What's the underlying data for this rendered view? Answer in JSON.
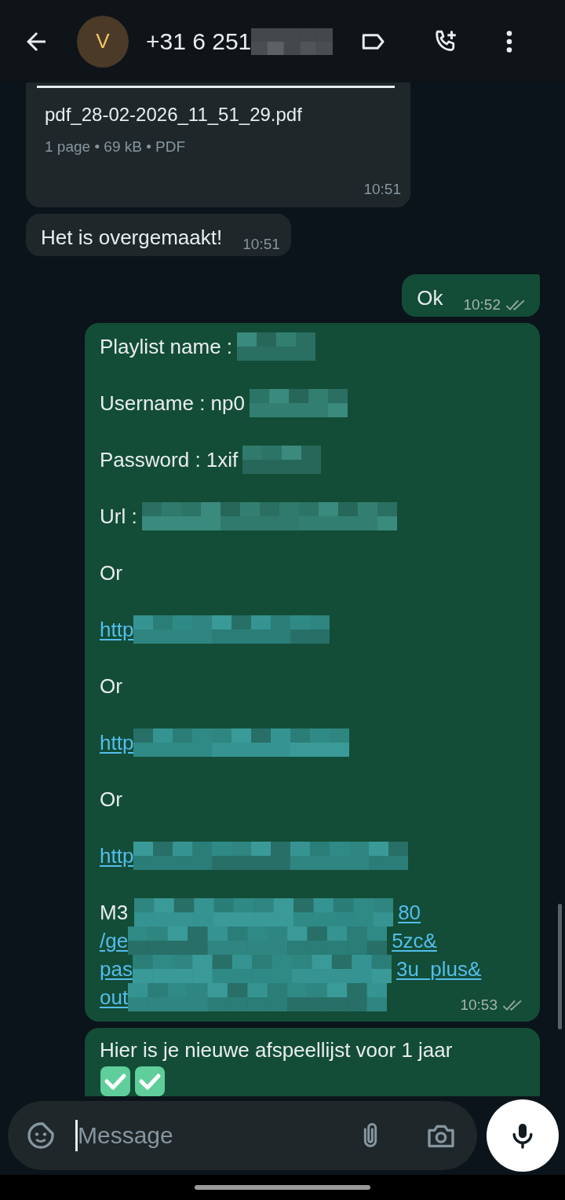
{
  "header": {
    "avatar_initial": "V",
    "title": "+31 6 251",
    "title_redacted": true
  },
  "messages": [
    {
      "kind": "document",
      "outgoing": false,
      "file_name": "pdf_28-02-2026_11_51_29.pdf",
      "meta": "1 page • 69 kB • PDF",
      "time": "10:51"
    },
    {
      "kind": "text",
      "outgoing": false,
      "text": "Het is overgemaakt!",
      "time": "10:51"
    },
    {
      "kind": "text",
      "outgoing": true,
      "text": "Ok",
      "time": "10:52",
      "read": false
    },
    {
      "kind": "rich",
      "outgoing": true,
      "time": "10:53",
      "read": false,
      "paragraphs": [
        {
          "lines": [
            [
              {
                "kind": "text",
                "text": "Playlist name :"
              },
              {
                "kind": "redacted"
              }
            ]
          ]
        },
        {
          "lines": [
            [
              {
                "kind": "text",
                "text": "Username : np0"
              },
              {
                "kind": "redacted"
              }
            ]
          ]
        },
        {
          "lines": [
            [
              {
                "kind": "text",
                "text": "Password : 1xif"
              },
              {
                "kind": "redacted"
              }
            ]
          ]
        },
        {
          "lines": [
            [
              {
                "kind": "text",
                "text": "Url :"
              },
              {
                "kind": "redacted"
              }
            ]
          ]
        },
        {
          "lines": [
            [
              {
                "kind": "text",
                "text": "Or"
              }
            ]
          ]
        },
        {
          "lines": [
            [
              {
                "kind": "link",
                "text": "http"
              },
              {
                "kind": "redacted"
              }
            ]
          ]
        },
        {
          "lines": [
            [
              {
                "kind": "text",
                "text": "Or"
              }
            ]
          ]
        },
        {
          "lines": [
            [
              {
                "kind": "link",
                "text": "http"
              },
              {
                "kind": "redacted"
              }
            ]
          ]
        },
        {
          "lines": [
            [
              {
                "kind": "text",
                "text": "Or"
              }
            ]
          ]
        },
        {
          "lines": [
            [
              {
                "kind": "link",
                "text": "http"
              },
              {
                "kind": "redacted"
              }
            ]
          ]
        },
        {
          "lines": [
            [
              {
                "kind": "text",
                "text": "M3"
              },
              {
                "kind": "redacted"
              },
              {
                "kind": "link",
                "text": "80"
              }
            ],
            [
              {
                "kind": "link",
                "text": "/ge"
              },
              {
                "kind": "redacted"
              },
              {
                "kind": "link",
                "text": "5zc&"
              }
            ],
            [
              {
                "kind": "link",
                "text": "pas"
              },
              {
                "kind": "redacted"
              },
              {
                "kind": "link",
                "text": "3u_plus&"
              }
            ],
            [
              {
                "kind": "link",
                "text": "out"
              },
              {
                "kind": "redacted"
              }
            ]
          ]
        }
      ]
    },
    {
      "kind": "emoji_text",
      "outgoing": true,
      "text": "Hier is je nieuwe afspeellijst voor 1 jaar",
      "attachments": [
        {
          "kind": "check-emoji"
        },
        {
          "kind": "check-emoji"
        }
      ]
    }
  ],
  "composer": {
    "placeholder": "Message"
  }
}
